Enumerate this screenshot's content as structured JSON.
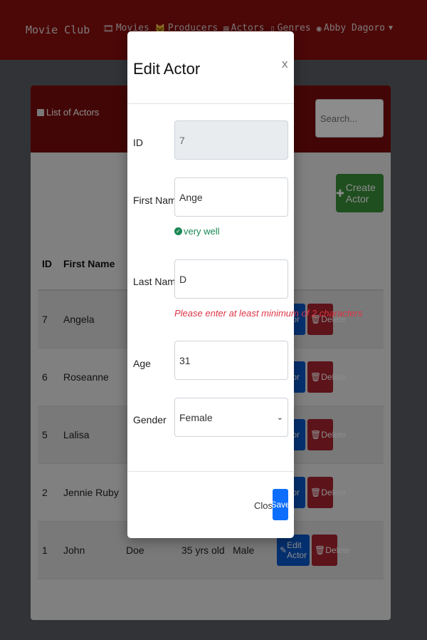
{
  "navbar": {
    "brand": "Movie Club",
    "links": [
      {
        "icon": "film-icon",
        "label": "Movies"
      },
      {
        "icon": "cat-icon",
        "label": "Producers"
      },
      {
        "icon": "list-icon",
        "label": "Actors"
      },
      {
        "icon": "device-icon",
        "label": "Genres"
      },
      {
        "icon": "user-icon",
        "label": "Abby Dagoro"
      }
    ]
  },
  "card": {
    "title": "List of Actors",
    "search_placeholder": "Search...",
    "create_label": "Create Actor"
  },
  "table": {
    "headers": [
      "ID",
      "First Name"
    ],
    "rows": [
      {
        "id": "7",
        "first": "Angela",
        "last": "",
        "age": "",
        "gender": ""
      },
      {
        "id": "6",
        "first": "Roseanne",
        "last": "",
        "age": "",
        "gender": ""
      },
      {
        "id": "5",
        "first": "Lalisa",
        "last": "",
        "age": "",
        "gender": ""
      },
      {
        "id": "2",
        "first": "Jennie Ruby",
        "last": "",
        "age": "",
        "gender": ""
      },
      {
        "id": "1",
        "first": "John",
        "last": "Doe",
        "age": "35 yrs old",
        "gender": "Male"
      }
    ],
    "edit_label_full": "Edit Actor",
    "edit_label_short": "Actor",
    "delete_label": "Delete"
  },
  "modal": {
    "title": "Edit Actor",
    "close_x": "x",
    "fields": {
      "id_label": "ID",
      "id_value": "7",
      "first_label": "First Name",
      "first_value": "Ange",
      "first_valid_msg": "very well",
      "last_label": "Last Name",
      "last_value": "D",
      "last_invalid_msg": "Please enter at least minimum of 2 characters",
      "age_label": "Age",
      "age_value": "31",
      "gender_label": "Gender",
      "gender_value": "Female"
    },
    "close_label": "Close",
    "save_label": "Save"
  },
  "colors": {
    "navbar": "#8b0d0d",
    "card_header": "#7a0c0c",
    "create_button": "#3a8f3a",
    "edit_button": "#0a58ca",
    "delete_button": "#a8232e",
    "save_button": "#0d6efd",
    "valid": "#198754",
    "invalid": "#dc3545"
  }
}
